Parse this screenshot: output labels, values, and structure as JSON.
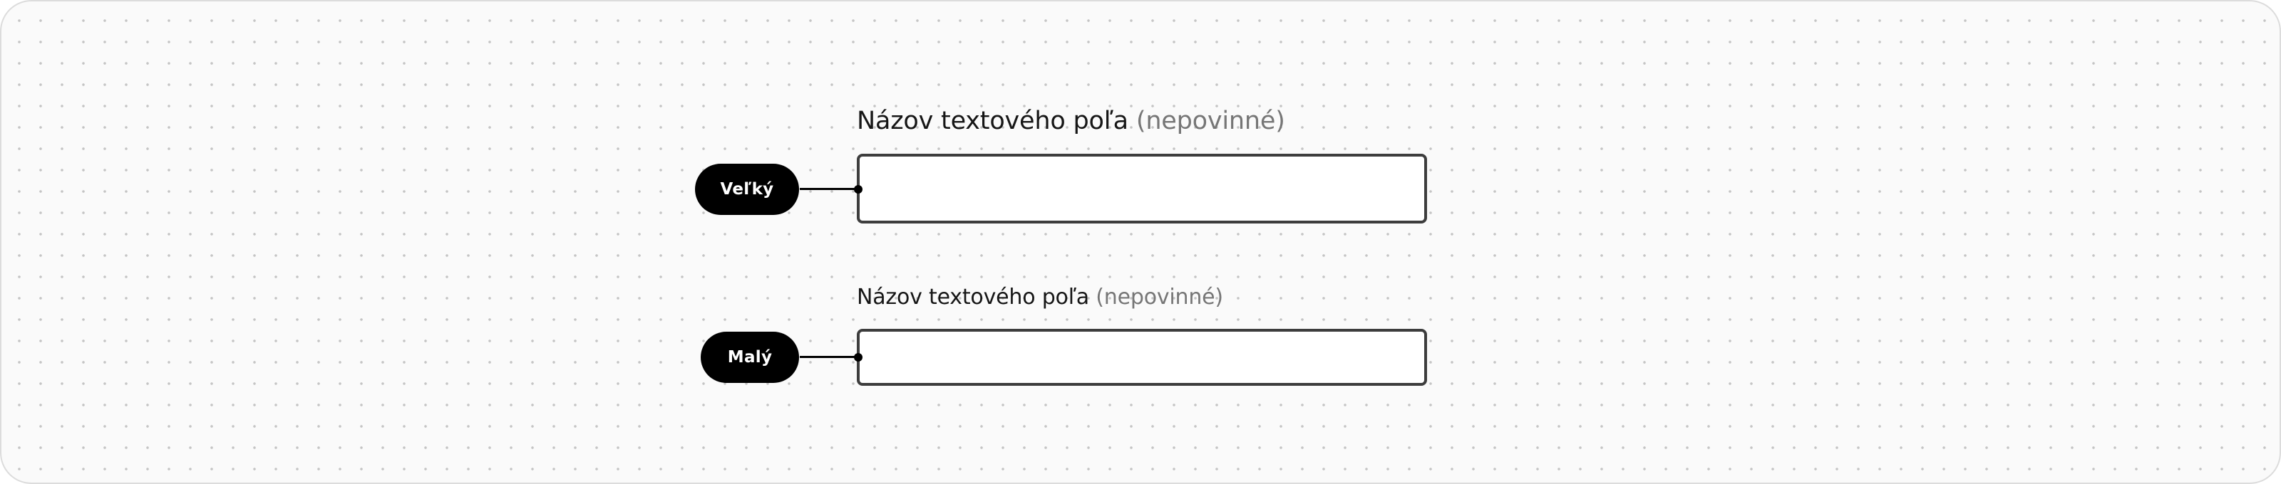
{
  "fields": {
    "large": {
      "size_tag": "Veľký",
      "label": "Názov textového poľa",
      "optional_hint": "(nepovinné)",
      "value": ""
    },
    "small": {
      "size_tag": "Malý",
      "label": "Názov textového poľa",
      "optional_hint": "(nepovinné)",
      "value": ""
    }
  },
  "colors": {
    "canvas_background": "#fafafa",
    "grid_dot": "#c4c4c4",
    "input_border": "#3d3d3d",
    "tag_background": "#000000",
    "tag_text": "#ffffff",
    "label_text": "#161616",
    "optional_text": "#767676"
  }
}
